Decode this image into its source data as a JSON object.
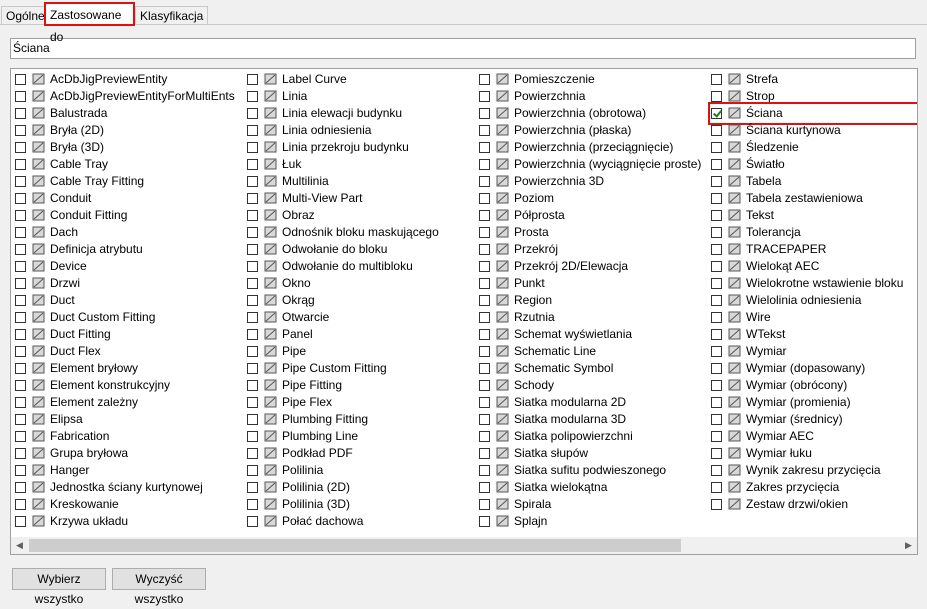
{
  "tabs": [
    {
      "label": "Ogólne",
      "active": false
    },
    {
      "label": "Zastosowane do",
      "active": true
    },
    {
      "label": "Klasyfikacja",
      "active": false
    }
  ],
  "search": {
    "value": "Ściana"
  },
  "columns": [
    [
      {
        "label": "AcDbJigPreviewEntity",
        "icon": "brush-icon",
        "checked": false
      },
      {
        "label": "AcDbJigPreviewEntityForMultiEnts",
        "icon": "brush-icon",
        "checked": false
      },
      {
        "label": "Balustrada",
        "icon": "railing-icon",
        "checked": false
      },
      {
        "label": "Bryła (2D)",
        "icon": "mass-2d-icon",
        "checked": false
      },
      {
        "label": "Bryła (3D)",
        "icon": "mass-3d-icon",
        "checked": false
      },
      {
        "label": "Cable Tray",
        "icon": "cable-tray-icon",
        "checked": false
      },
      {
        "label": "Cable Tray Fitting",
        "icon": "cable-tray-fitting-icon",
        "checked": false
      },
      {
        "label": "Conduit",
        "icon": "conduit-icon",
        "checked": false
      },
      {
        "label": "Conduit Fitting",
        "icon": "conduit-fitting-icon",
        "checked": false
      },
      {
        "label": "Dach",
        "icon": "roof-icon",
        "checked": false
      },
      {
        "label": "Definicja atrybutu",
        "icon": "attribute-tag-icon",
        "checked": false
      },
      {
        "label": "Device",
        "icon": "device-icon",
        "checked": false
      },
      {
        "label": "Drzwi",
        "icon": "door-icon",
        "checked": false
      },
      {
        "label": "Duct",
        "icon": "duct-icon",
        "checked": false
      },
      {
        "label": "Duct Custom Fitting",
        "icon": "duct-custom-fitting-icon",
        "checked": false
      },
      {
        "label": "Duct Fitting",
        "icon": "duct-fitting-icon",
        "checked": false
      },
      {
        "label": "Duct Flex",
        "icon": "duct-flex-icon",
        "checked": false
      },
      {
        "label": "Element bryłowy",
        "icon": "mass-element-icon",
        "checked": false
      },
      {
        "label": "Element konstrukcyjny",
        "icon": "structural-member-icon",
        "checked": false
      },
      {
        "label": "Element zależny",
        "icon": "dependent-element-icon",
        "checked": false
      },
      {
        "label": "Elipsa",
        "icon": "ellipse-icon",
        "checked": false
      },
      {
        "label": "Fabrication",
        "icon": "fabrication-icon",
        "checked": false
      },
      {
        "label": "Grupa bryłowa",
        "icon": "mass-group-icon",
        "checked": false
      },
      {
        "label": "Hanger",
        "icon": "hanger-icon",
        "checked": false
      },
      {
        "label": "Jednostka ściany kurtynowej",
        "icon": "curtain-wall-unit-icon",
        "checked": false
      },
      {
        "label": "Kreskowanie",
        "icon": "hatch-icon",
        "checked": false
      },
      {
        "label": "Krzywa układu",
        "icon": "layout-curve-icon",
        "checked": false
      }
    ],
    [
      {
        "label": "Label Curve",
        "icon": "label-curve-icon",
        "checked": false
      },
      {
        "label": "Linia",
        "icon": "line-icon",
        "checked": false
      },
      {
        "label": "Linia elewacji budynku",
        "icon": "elevation-line-icon",
        "checked": false
      },
      {
        "label": "Linia odniesienia",
        "icon": "reference-line-icon",
        "checked": false
      },
      {
        "label": "Linia przekroju budynku",
        "icon": "section-line-icon",
        "checked": false
      },
      {
        "label": "Łuk",
        "icon": "arc-icon",
        "checked": false
      },
      {
        "label": "Multilinia",
        "icon": "multiline-icon",
        "checked": false
      },
      {
        "label": "Multi-View Part",
        "icon": "multi-view-part-icon",
        "checked": false
      },
      {
        "label": "Obraz",
        "icon": "image-icon",
        "checked": false
      },
      {
        "label": "Odnośnik bloku maskującego",
        "icon": "mask-block-reference-icon",
        "checked": false
      },
      {
        "label": "Odwołanie do bloku",
        "icon": "block-reference-icon",
        "checked": false
      },
      {
        "label": "Odwołanie do multibloku",
        "icon": "multi-block-reference-icon",
        "checked": false
      },
      {
        "label": "Okno",
        "icon": "window-icon",
        "checked": false
      },
      {
        "label": "Okrąg",
        "icon": "circle-icon",
        "checked": false
      },
      {
        "label": "Otwarcie",
        "icon": "opening-icon",
        "checked": false
      },
      {
        "label": "Panel",
        "icon": "panel-icon",
        "checked": false
      },
      {
        "label": "Pipe",
        "icon": "pipe-icon",
        "checked": false
      },
      {
        "label": "Pipe Custom Fitting",
        "icon": "pipe-custom-fitting-icon",
        "checked": false
      },
      {
        "label": "Pipe Fitting",
        "icon": "pipe-fitting-icon",
        "checked": false
      },
      {
        "label": "Pipe Flex",
        "icon": "pipe-flex-icon",
        "checked": false
      },
      {
        "label": "Plumbing Fitting",
        "icon": "plumbing-fitting-icon",
        "checked": false
      },
      {
        "label": "Plumbing Line",
        "icon": "plumbing-line-icon",
        "checked": false
      },
      {
        "label": "Podkład PDF",
        "icon": "pdf-underlay-icon",
        "checked": false
      },
      {
        "label": "Polilinia",
        "icon": "polyline-icon",
        "checked": false
      },
      {
        "label": "Polilinia (2D)",
        "icon": "polyline-2d-icon",
        "checked": false
      },
      {
        "label": "Polilinia (3D)",
        "icon": "polyline-3d-icon",
        "checked": false
      },
      {
        "label": "Połać dachowa",
        "icon": "roof-slab-icon",
        "checked": false
      }
    ],
    [
      {
        "label": "Pomieszczenie",
        "icon": "space-icon",
        "checked": false
      },
      {
        "label": "Powierzchnia",
        "icon": "surface-icon",
        "checked": false
      },
      {
        "label": "Powierzchnia (obrotowa)",
        "icon": "revolved-surface-icon",
        "checked": false
      },
      {
        "label": "Powierzchnia (płaska)",
        "icon": "planar-surface-icon",
        "checked": false
      },
      {
        "label": "Powierzchnia (przeciągnięcie)",
        "icon": "swept-surface-icon",
        "checked": false
      },
      {
        "label": "Powierzchnia (wyciągnięcie proste)",
        "icon": "extruded-surface-icon",
        "checked": false
      },
      {
        "label": "Powierzchnia 3D",
        "icon": "surface-3d-icon",
        "checked": false
      },
      {
        "label": "Poziom",
        "icon": "level-icon",
        "checked": false
      },
      {
        "label": "Półprosta",
        "icon": "ray-icon",
        "checked": false
      },
      {
        "label": "Prosta",
        "icon": "xline-icon",
        "checked": false
      },
      {
        "label": "Przekrój",
        "icon": "section-icon",
        "checked": false
      },
      {
        "label": "Przekrój 2D/Elewacja",
        "icon": "section-2d-elevation-icon",
        "checked": false
      },
      {
        "label": "Punkt",
        "icon": "point-icon",
        "checked": false
      },
      {
        "label": "Region",
        "icon": "region-icon",
        "checked": false
      },
      {
        "label": "Rzutnia",
        "icon": "viewport-icon",
        "checked": false
      },
      {
        "label": "Schemat wyświetlania",
        "icon": "display-schema-icon",
        "checked": false
      },
      {
        "label": "Schematic Line",
        "icon": "schematic-line-icon",
        "checked": false
      },
      {
        "label": "Schematic Symbol",
        "icon": "schematic-symbol-icon",
        "checked": false
      },
      {
        "label": "Schody",
        "icon": "stair-icon",
        "checked": false
      },
      {
        "label": "Siatka modularna 2D",
        "icon": "grid-2d-icon",
        "checked": false
      },
      {
        "label": "Siatka modularna 3D",
        "icon": "grid-3d-icon",
        "checked": false
      },
      {
        "label": "Siatka polipowierzchni",
        "icon": "polyface-mesh-icon",
        "checked": false
      },
      {
        "label": "Siatka słupów",
        "icon": "column-grid-icon",
        "checked": false
      },
      {
        "label": "Siatka sufitu podwieszonego",
        "icon": "ceiling-grid-icon",
        "checked": false
      },
      {
        "label": "Siatka wielokątna",
        "icon": "polygon-mesh-icon",
        "checked": false
      },
      {
        "label": "Spirala",
        "icon": "helix-icon",
        "checked": false
      },
      {
        "label": "Splajn",
        "icon": "spline-icon",
        "checked": false
      }
    ],
    [
      {
        "label": "Strefa",
        "icon": "zone-icon",
        "checked": false
      },
      {
        "label": "Strop",
        "icon": "slab-icon",
        "checked": false
      },
      {
        "label": "Ściana",
        "icon": "wall-icon",
        "checked": true
      },
      {
        "label": "Ściana kurtynowa",
        "icon": "curtain-wall-icon",
        "checked": false
      },
      {
        "label": "Śledzenie",
        "icon": "trace-icon",
        "checked": false
      },
      {
        "label": "Światło",
        "icon": "light-bulb-icon",
        "checked": false
      },
      {
        "label": "Tabela",
        "icon": "table-icon",
        "checked": false
      },
      {
        "label": "Tabela zestawieniowa",
        "icon": "schedule-table-icon",
        "checked": false
      },
      {
        "label": "Tekst",
        "icon": "text-icon",
        "checked": false
      },
      {
        "label": "Tolerancja",
        "icon": "tolerance-icon",
        "checked": false
      },
      {
        "label": "TRACEPAPER",
        "icon": "brush-icon",
        "checked": false
      },
      {
        "label": "Wielokąt AEC",
        "icon": "aec-polygon-icon",
        "checked": false
      },
      {
        "label": "Wielokrotne wstawienie bloku",
        "icon": "minsert-block-icon",
        "checked": false
      },
      {
        "label": "Wielolinia odniesienia",
        "icon": "multileader-icon",
        "checked": false
      },
      {
        "label": "Wire",
        "icon": "wire-icon",
        "checked": false
      },
      {
        "label": "WTekst",
        "icon": "mtext-icon",
        "checked": false
      },
      {
        "label": "Wymiar",
        "icon": "dimension-icon",
        "checked": false
      },
      {
        "label": "Wymiar (dopasowany)",
        "icon": "aligned-dimension-icon",
        "checked": false
      },
      {
        "label": "Wymiar (obrócony)",
        "icon": "rotated-dimension-icon",
        "checked": false
      },
      {
        "label": "Wymiar (promienia)",
        "icon": "radial-dimension-icon",
        "checked": false
      },
      {
        "label": "Wymiar (średnicy)",
        "icon": "diametric-dimension-icon",
        "checked": false
      },
      {
        "label": "Wymiar AEC",
        "icon": "aec-dimension-icon",
        "checked": false
      },
      {
        "label": "Wymiar łuku",
        "icon": "arc-dimension-icon",
        "checked": false
      },
      {
        "label": "Wynik zakresu przycięcia",
        "icon": "clip-result-icon",
        "checked": false
      },
      {
        "label": "Zakres przycięcia",
        "icon": "clip-range-icon",
        "checked": false
      },
      {
        "label": "Zestaw drzwi/okien",
        "icon": "door-window-assembly-icon",
        "checked": false
      }
    ]
  ],
  "buttons": {
    "select_all": "Wybierz wszystko",
    "clear_all": "Wyczyść wszystko"
  }
}
